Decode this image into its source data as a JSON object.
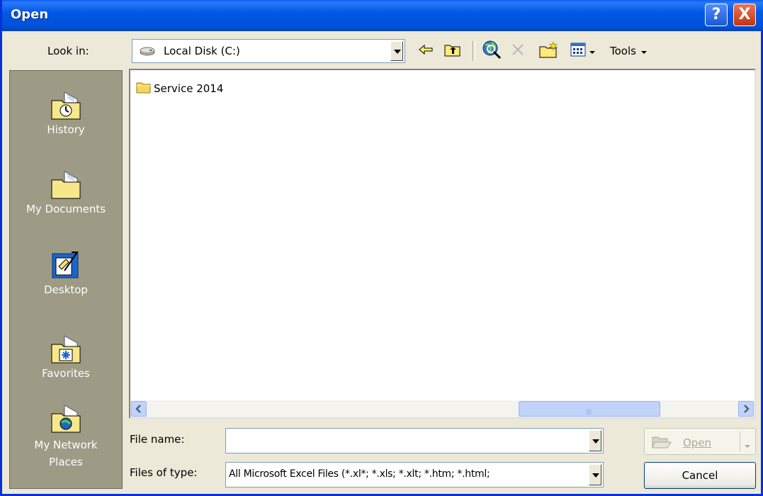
{
  "window": {
    "title": "Open"
  },
  "title_buttons": {
    "help": "?",
    "close": "X"
  },
  "look_in": {
    "label": "Look in:",
    "value": "Local Disk (C:)"
  },
  "toolbar": {
    "tools_label": "Tools"
  },
  "places": [
    {
      "label": "History",
      "icon": "history-icon"
    },
    {
      "label": "My Documents",
      "icon": "my-documents-icon"
    },
    {
      "label": "Desktop",
      "icon": "desktop-icon"
    },
    {
      "label": "Favorites",
      "icon": "favorites-icon"
    },
    {
      "label": "My Network Places",
      "icon": "network-places-icon"
    }
  ],
  "files": [
    {
      "name": "Service 2014",
      "icon": "folder-icon"
    }
  ],
  "file_name": {
    "label": "File name:",
    "value": ""
  },
  "file_type": {
    "label": "Files of type:",
    "value": "All Microsoft Excel Files (*.xl*; *.xls; *.xlt; *.htm; *.html;"
  },
  "buttons": {
    "open": "Open",
    "cancel": "Cancel"
  },
  "colors": {
    "titlebar": "#0058e6",
    "places_bar": "#9d9a85",
    "dialog_bg": "#ece9d8"
  }
}
